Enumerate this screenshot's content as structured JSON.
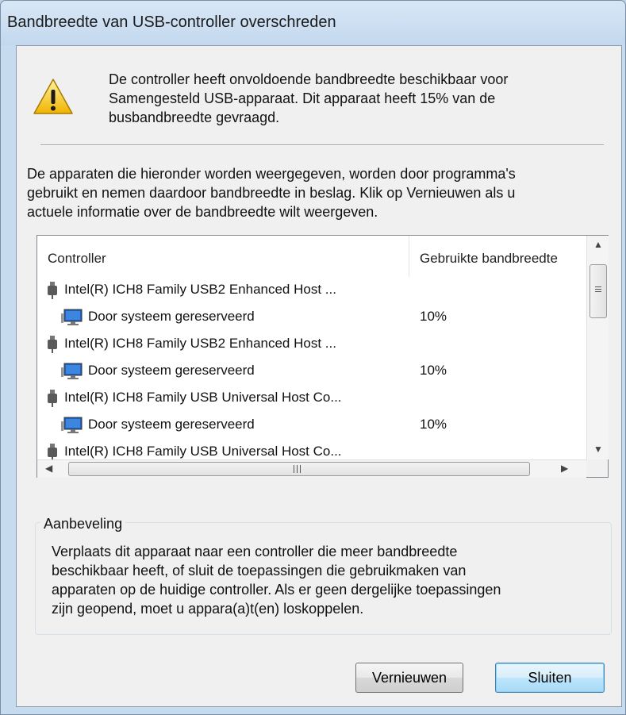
{
  "window": {
    "title": "Bandbreedte van USB-controller overschreden"
  },
  "message": {
    "icon": "warning-icon",
    "line1": "De controller heeft onvoldoende bandbreedte beschikbaar voor",
    "line2": "Samengesteld USB-apparaat. Dit apparaat heeft 15% van de",
    "line3": "busbandbreedte gevraagd."
  },
  "description": {
    "line1": "De apparaten die hieronder worden weergegeven, worden door programma's",
    "line2": "gebruikt en nemen daardoor bandbreedte in beslag. Klik op Vernieuwen als u",
    "line3": "actuele informatie over de bandbreedte wilt weergeven."
  },
  "list": {
    "columns": [
      "Controller",
      "Gebruikte bandbreedte"
    ],
    "rows": [
      {
        "type": "controller",
        "icon": "usb-plug-icon",
        "name": "Intel(R) ICH8 Family USB2 Enhanced Host ...",
        "value": ""
      },
      {
        "type": "device",
        "icon": "computer-icon",
        "name": "Door systeem gereserveerd",
        "value": "10%"
      },
      {
        "type": "controller",
        "icon": "usb-plug-icon",
        "name": "Intel(R) ICH8 Family USB2 Enhanced Host ...",
        "value": ""
      },
      {
        "type": "device",
        "icon": "computer-icon",
        "name": "Door systeem gereserveerd",
        "value": "10%"
      },
      {
        "type": "controller",
        "icon": "usb-plug-icon",
        "name": "Intel(R) ICH8 Family USB Universal Host Co...",
        "value": ""
      },
      {
        "type": "device",
        "icon": "computer-icon",
        "name": "Door systeem gereserveerd",
        "value": "10%"
      },
      {
        "type": "controller",
        "icon": "usb-plug-icon",
        "name": "Intel(R) ICH8 Family USB Universal Host Co...",
        "value": ""
      }
    ]
  },
  "recommendation": {
    "title": "Aanbeveling",
    "line1": "Verplaats dit apparaat naar een controller die meer bandbreedte",
    "line2": "beschikbaar heeft, of sluit de toepassingen die gebruikmaken van",
    "line3": "apparaten op de huidige controller. Als er geen dergelijke toepassingen",
    "line4": "zijn geopend, moet u appara(a)t(en) loskoppelen."
  },
  "buttons": {
    "refresh": "Vernieuwen",
    "close": "Sluiten"
  },
  "colors": {
    "accent": "#3c7fb1",
    "frame": "#c7dbee",
    "warning": "#f5c400"
  }
}
